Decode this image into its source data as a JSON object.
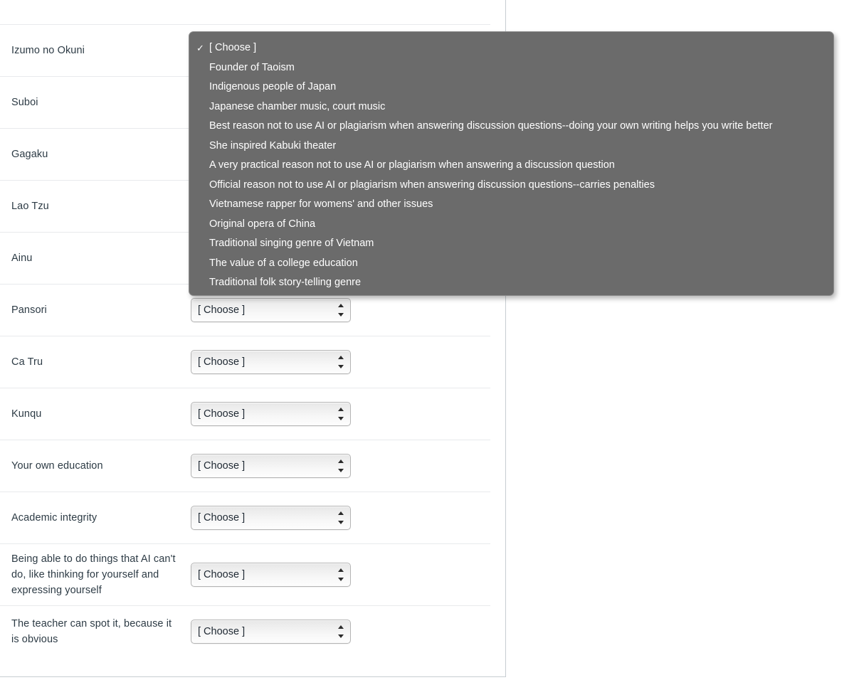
{
  "select_placeholder": "[ Choose ]",
  "dropdown": {
    "name": "answer-options-popup",
    "selected_index": 0,
    "check_glyph": "✓",
    "items": [
      {
        "label": "[ Choose ]",
        "checked": true
      },
      {
        "label": "Founder of Taoism",
        "checked": false
      },
      {
        "label": "Indigenous people of Japan",
        "checked": false
      },
      {
        "label": "Japanese chamber music, court music",
        "checked": false
      },
      {
        "label": "Best reason not to use AI or plagiarism when answering discussion questions--doing your own writing helps you write better",
        "checked": false
      },
      {
        "label": "She inspired Kabuki theater",
        "checked": false
      },
      {
        "label": "A very practical reason not to use AI or plagiarism when answering a discussion question",
        "checked": false
      },
      {
        "label": "Official reason not to use AI or plagiarism when answering discussion questions--carries penalties",
        "checked": false
      },
      {
        "label": "Vietnamese rapper for womens' and other issues",
        "checked": false
      },
      {
        "label": "Original opera of China",
        "checked": false
      },
      {
        "label": "Traditional singing genre of Vietnam",
        "checked": false
      },
      {
        "label": "The value of a college education",
        "checked": false
      },
      {
        "label": "Traditional folk story-telling genre",
        "checked": false
      }
    ]
  },
  "rows": [
    {
      "label": "Izumo no Okuni",
      "value": "[ Choose ]"
    },
    {
      "label": "Suboi",
      "value": "[ Choose ]"
    },
    {
      "label": "Gagaku",
      "value": "[ Choose ]"
    },
    {
      "label": "Lao Tzu",
      "value": "[ Choose ]"
    },
    {
      "label": "Ainu",
      "value": "[ Choose ]"
    },
    {
      "label": "Pansori",
      "value": "[ Choose ]"
    },
    {
      "label": "Ca Tru",
      "value": "[ Choose ]"
    },
    {
      "label": "Kunqu",
      "value": "[ Choose ]"
    },
    {
      "label": "Your own education",
      "value": "[ Choose ]"
    },
    {
      "label": "Academic integrity",
      "value": "[ Choose ]"
    },
    {
      "label": "Being able to do things that AI can't do, like thinking for yourself and expressing yourself",
      "value": "[ Choose ]"
    },
    {
      "label": "The teacher can spot it, because it is obvious",
      "value": "[ Choose ]"
    }
  ],
  "colors": {
    "page_background": "#ffffff",
    "text": "#2d3b45",
    "row_divider": "#e8eaec",
    "container_border": "#c7cdd1",
    "popup_background": "#6b6b6b",
    "popup_text": "#ffffff"
  }
}
